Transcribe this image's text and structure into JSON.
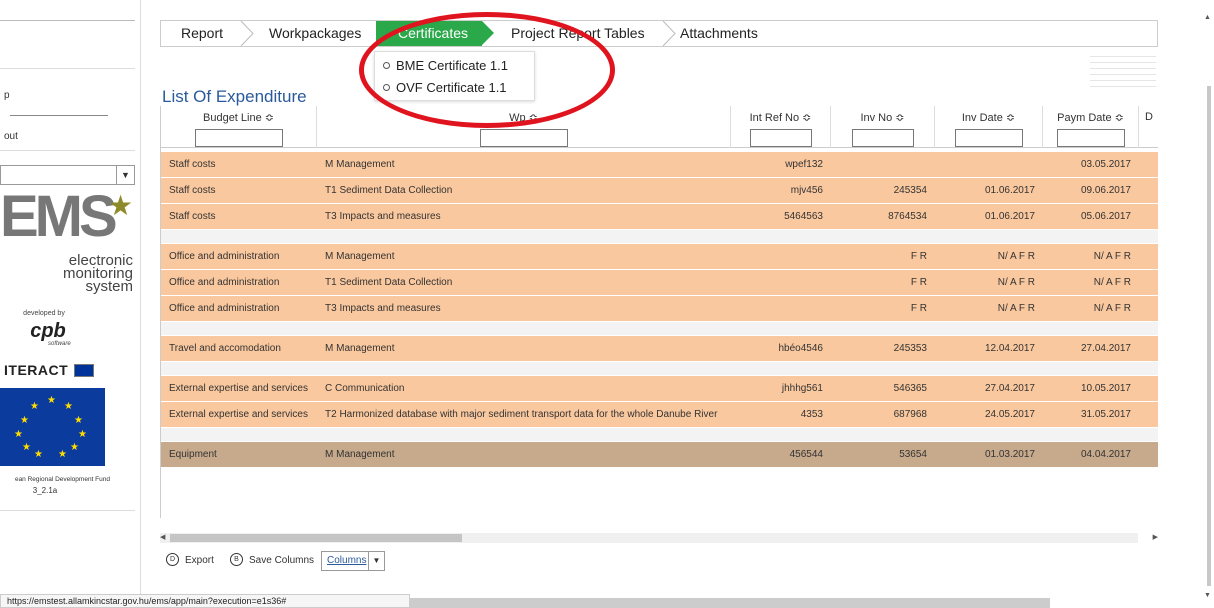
{
  "sidebar": {
    "text1": "p",
    "text2": "out",
    "logo_main": "EMS",
    "logo_star": "★",
    "logo_sub": [
      "electronic",
      "monitoring",
      "system"
    ],
    "developed_by": "developed by",
    "cpb": "cpb",
    "cpb_sub": "software",
    "interact": "ITERACT",
    "fund": "ean Regional Development Fund",
    "version": "3_2.1a"
  },
  "tabs": [
    "Report",
    "Workpackages",
    "Certificates",
    "Project Report Tables",
    "Attachments"
  ],
  "active_tab": "Certificates",
  "cert_menu": [
    "BME Certificate 1.1",
    "OVF Certificate 1.1"
  ],
  "list_title": "List Of Expenditure",
  "columns": [
    "Budget Line ≎",
    "Wp ≎",
    "Int Ref No ≎",
    "Inv No ≎",
    "Inv Date ≎",
    "Paym Date ≎",
    "D"
  ],
  "rows": [
    {
      "budget": "Staff costs",
      "wp": "M Management",
      "ref": "wpef132",
      "inv": "",
      "inv_date": "",
      "paym": "03.05.2017"
    },
    {
      "budget": "Staff costs",
      "wp": "T1 Sediment Data Collection",
      "ref": "mjv456",
      "inv": "245354",
      "inv_date": "01.06.2017",
      "paym": "09.06.2017"
    },
    {
      "budget": "Staff costs",
      "wp": "T3 Impacts and measures",
      "ref": "5464563",
      "inv": "8764534",
      "inv_date": "01.06.2017",
      "paym": "05.06.2017"
    },
    {
      "spacer": true
    },
    {
      "budget": "Office and administration",
      "wp": "M Management",
      "ref": "",
      "inv": "F R",
      "inv_date": "N/ A F R",
      "paym": "N/ A F R"
    },
    {
      "budget": "Office and administration",
      "wp": "T1 Sediment Data Collection",
      "ref": "",
      "inv": "F R",
      "inv_date": "N/ A F R",
      "paym": "N/ A F R"
    },
    {
      "budget": "Office and administration",
      "wp": "T3 Impacts and measures",
      "ref": "",
      "inv": "F R",
      "inv_date": "N/ A F R",
      "paym": "N/ A F R"
    },
    {
      "spacer": true
    },
    {
      "budget": "Travel and accomodation",
      "wp": "M Management",
      "ref": "hbéo4546",
      "inv": "245353",
      "inv_date": "12.04.2017",
      "paym": "27.04.2017"
    },
    {
      "spacer": true
    },
    {
      "budget": "External expertise and services",
      "wp": "C Communication",
      "ref": "jhhhg561",
      "inv": "546365",
      "inv_date": "27.04.2017",
      "paym": "10.05.2017"
    },
    {
      "budget": "External expertise and services",
      "wp": "T2 Harmonized database with major sediment transport data for the whole Danube River",
      "ref": "4353",
      "inv": "687968",
      "inv_date": "24.05.2017",
      "paym": "31.05.2017"
    },
    {
      "spacer": true
    },
    {
      "budget": "Equipment",
      "wp": "M Management",
      "ref": "456544",
      "inv": "53654",
      "inv_date": "01.03.2017",
      "paym": "04.04.2017",
      "equip": true
    }
  ],
  "footer": {
    "export_label": "Export",
    "export_icon": "D",
    "save_label": "Save Columns",
    "save_icon": "B",
    "columns_label": "Columns"
  },
  "status_url": "https://emstest.allamkincstar.gov.hu/ems/app/main?execution=e1s36#",
  "colors": {
    "tab_active": "#2aa84a",
    "row": "#fac89e",
    "row_equipment": "#c7a98b",
    "annotation": "#e0141e",
    "title": "#2a5a9a"
  }
}
